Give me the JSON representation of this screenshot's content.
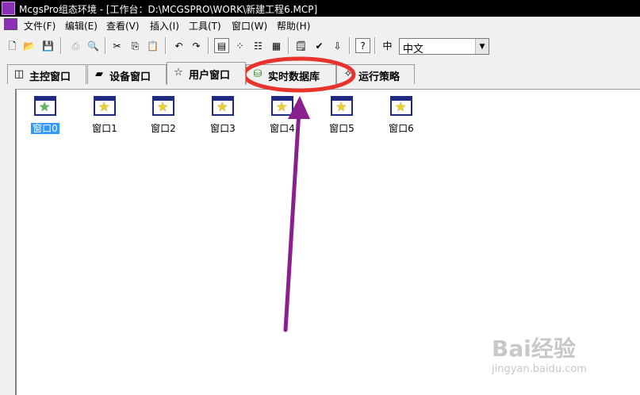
{
  "window": {
    "title": "McgsPro组态环境 - [工作台：D:\\MCGSPRO\\WORK\\新建工程6.MCP]"
  },
  "menu": {
    "items": [
      "文件(F)",
      "编辑(E)",
      "查看(V)",
      "插入(I)",
      "工具(T)",
      "窗口(W)",
      "帮助(H)"
    ]
  },
  "toolbar": {
    "language_value": "中文",
    "icons": [
      "new-icon",
      "open-icon",
      "save-icon",
      "print-icon",
      "print-preview-icon",
      "cut-icon",
      "copy-icon",
      "paste-icon",
      "undo-icon",
      "redo-icon",
      "large-icons-view-icon",
      "small-icons-view-icon",
      "list-view-icon",
      "details-view-icon",
      "properties-icon",
      "check-icon",
      "compile-icon",
      "help-icon",
      "language-icon"
    ]
  },
  "tabs": [
    {
      "label": "主控窗口",
      "icon": "main-window-icon"
    },
    {
      "label": "设备窗口",
      "icon": "device-window-icon"
    },
    {
      "label": "用户窗口",
      "icon": "user-window-icon",
      "active": true
    },
    {
      "label": "实时数据库",
      "icon": "database-icon",
      "highlighted": true
    },
    {
      "label": "运行策略",
      "icon": "strategy-icon"
    }
  ],
  "windows": [
    {
      "label": "窗口0",
      "selected": true
    },
    {
      "label": "窗口1"
    },
    {
      "label": "窗口2"
    },
    {
      "label": "窗口3"
    },
    {
      "label": "窗口4"
    },
    {
      "label": "窗口5"
    },
    {
      "label": "窗口6"
    }
  ],
  "annotation": {
    "circle_color": "#e8322c",
    "arrow_color": "#8a1f8e"
  },
  "watermark": {
    "brand": "Bai经验",
    "url": "jingyan.baidu.com"
  }
}
